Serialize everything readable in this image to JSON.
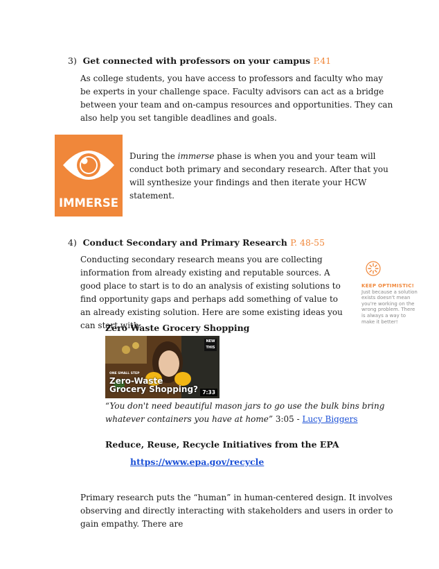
{
  "section3": {
    "number": "3)",
    "heading": "Get connected with professors on your campus",
    "page_ref": "P.41",
    "body": "As college students, you have access to professors and faculty who may be experts in your challenge space. Faculty advisors can act as a bridge between your team and on-campus resources and opportunities. They can also help you set tangible deadlines and goals."
  },
  "immerse": {
    "badge_label": "IMMERSE",
    "badge_color": "#f0873a",
    "icon": "eye-icon",
    "text_before": "During the ",
    "text_em": "immerse",
    "text_after": " phase is when you and your team will conduct both primary and secondary research. After that you will synthesize your findings and then iterate your HCW statement."
  },
  "section4": {
    "number": "4)",
    "heading": "Conduct Secondary and Primary Research",
    "page_ref": "P. 48-55",
    "body": "Conducting secondary research means you are collecting information from already existing and reputable sources. A good place to start is to do an analysis of existing solutions to find opportunity gaps and perhaps add something of value to an already existing solution. Here are some existing ideas  you can start with:"
  },
  "tip": {
    "icon": "sun-burst-icon",
    "title": "KEEP OPTIMISTIC!",
    "body": "Just because a solution exists doesn't mean you're working on the wrong problem. There is always a way to make it better!"
  },
  "idea1": {
    "title": "Zero Waste Grocery Shopping",
    "video": {
      "small_tag": "ONE SMALL STEP",
      "title_line1": "Zero-Waste",
      "title_line2": "Grocery Shopping?",
      "duration": "7:33",
      "badge": "NEW THIS"
    },
    "quote": "“You don't need beautiful mason jars to go use the bulk bins bring whatever containers you have at home”",
    "timestamp": " 3:05 - ",
    "link": "Lucy Biggers"
  },
  "idea2": {
    "title": "Reduce, Reuse, Recycle Initiatives from the EPA",
    "link": "https://www.epa.gov/recycle"
  },
  "primary": {
    "body": "Primary research puts the “human” in human-centered design. It involves observing and directly interacting with stakeholders and users in order to gain empathy. There are"
  }
}
